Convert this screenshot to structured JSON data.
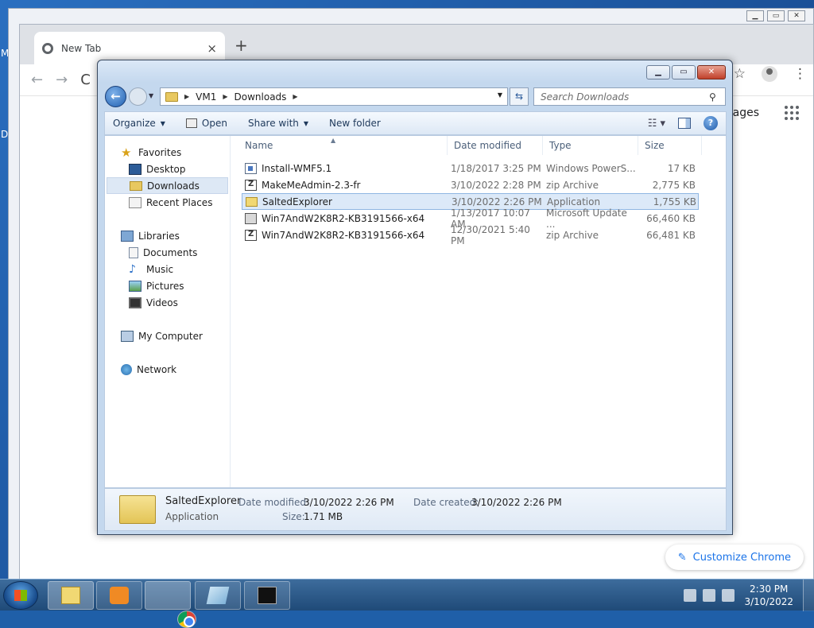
{
  "desktop": {
    "edge_letter_1": "M",
    "edge_letter_2": "D"
  },
  "chrome": {
    "tab_title": "New Tab",
    "tab_close": "×",
    "new_tab": "+",
    "back": "←",
    "forward": "→",
    "reload": "C",
    "star": "☆",
    "menu": "⋮",
    "images_link": "mages",
    "customize_label": "Customize Chrome",
    "customize_icon": "✎"
  },
  "explorer": {
    "window_buttons": {
      "minimize": "▁",
      "maximize": "▭",
      "close": "✕"
    },
    "address": {
      "crumbs": [
        "VM1",
        "Downloads"
      ]
    },
    "search_placeholder": "Search Downloads",
    "commands": {
      "organize": "Organize",
      "open": "Open",
      "share_with": "Share with",
      "new_folder": "New folder"
    },
    "nav": {
      "favorites": "Favorites",
      "desktop": "Desktop",
      "downloads": "Downloads",
      "recent_places": "Recent Places",
      "libraries": "Libraries",
      "documents": "Documents",
      "music": "Music",
      "pictures": "Pictures",
      "videos": "Videos",
      "my_computer": "My Computer",
      "network": "Network"
    },
    "columns": {
      "name": "Name",
      "date_modified": "Date modified",
      "type": "Type",
      "size": "Size"
    },
    "files": [
      {
        "name": "Install-WMF5.1",
        "date": "1/18/2017 3:25 PM",
        "type": "Windows PowerS...",
        "size": "17 KB",
        "icon": "powershell-script-icon"
      },
      {
        "name": "MakeMeAdmin-2.3-fr",
        "date": "3/10/2022 2:28 PM",
        "type": "zip Archive",
        "size": "2,775 KB",
        "icon": "zip-archive-icon"
      },
      {
        "name": "SaltedExplorer",
        "date": "3/10/2022 2:26 PM",
        "type": "Application",
        "size": "1,755 KB",
        "icon": "folder-icon",
        "selected": true
      },
      {
        "name": "Win7AndW2K8R2-KB3191566-x64",
        "date": "1/13/2017 10:07 AM",
        "type": "Microsoft Update ...",
        "size": "66,460 KB",
        "icon": "update-package-icon"
      },
      {
        "name": "Win7AndW2K8R2-KB3191566-x64",
        "date": "12/30/2021 5:40 PM",
        "type": "zip Archive",
        "size": "66,481 KB",
        "icon": "zip-archive-icon"
      }
    ],
    "details": {
      "name": "SaltedExplorer",
      "type": "Application",
      "date_modified_label": "Date modified:",
      "date_modified": "3/10/2022 2:26 PM",
      "date_created_label": "Date created:",
      "date_created": "3/10/2022 2:26 PM",
      "size_label": "Size:",
      "size": "1.71 MB"
    }
  },
  "taskbar": {
    "time": "2:30 PM",
    "date": "3/10/2022"
  }
}
